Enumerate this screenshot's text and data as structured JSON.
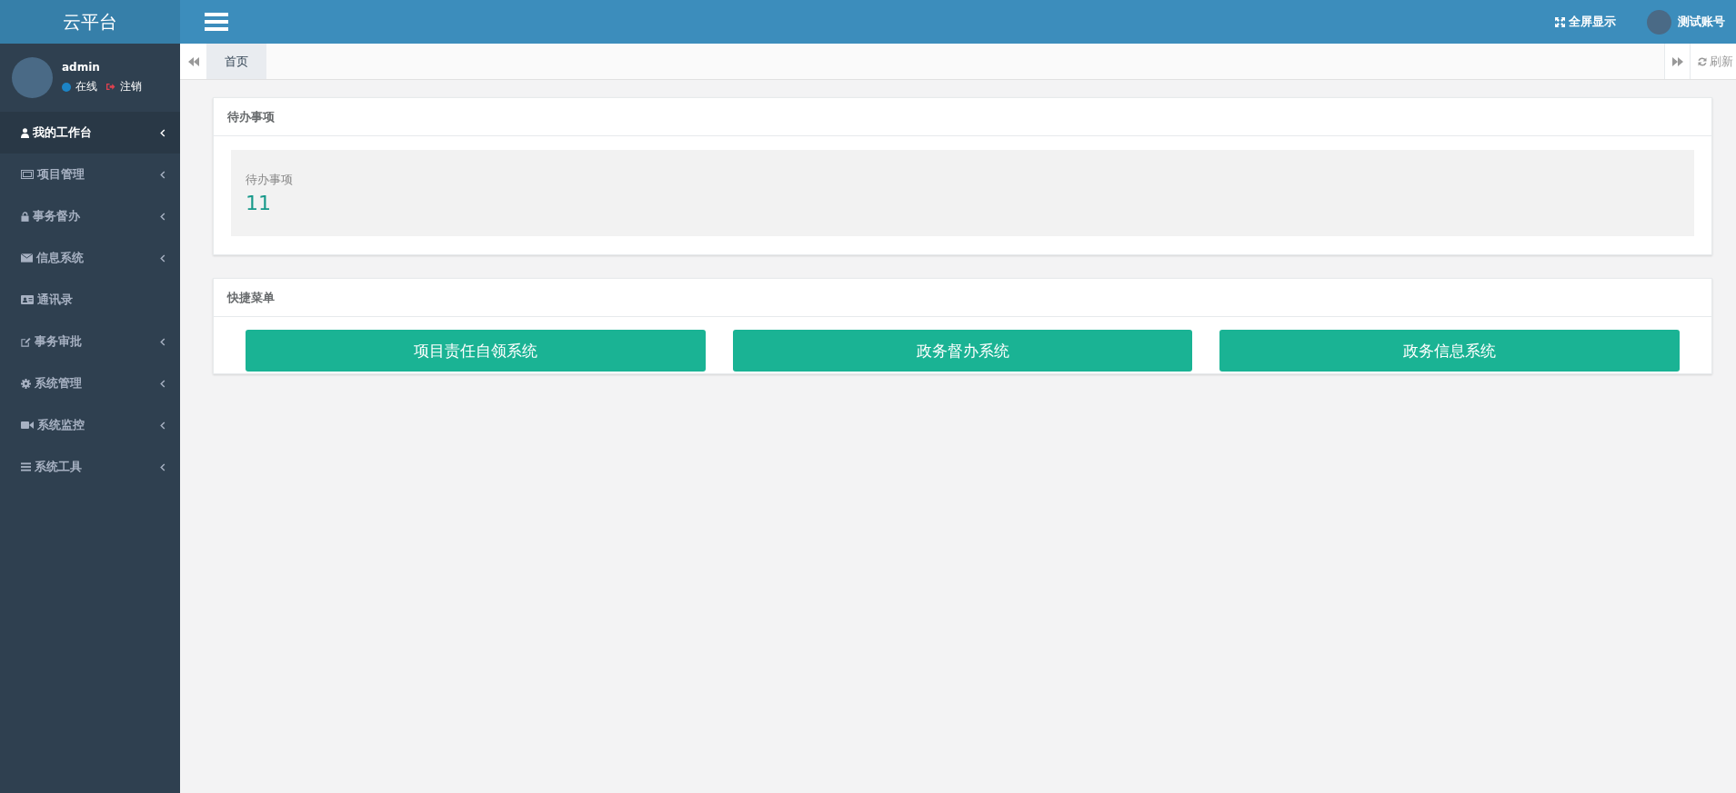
{
  "brand": "云平台",
  "user": {
    "name": "admin",
    "status": "在线",
    "logout": "注销"
  },
  "sidebar": {
    "items": [
      {
        "label": "我的工作台",
        "selected": true,
        "expandable": true
      },
      {
        "label": "项目管理",
        "selected": false,
        "expandable": true
      },
      {
        "label": "事务督办",
        "selected": false,
        "expandable": true
      },
      {
        "label": "信息系统",
        "selected": false,
        "expandable": true
      },
      {
        "label": "通讯录",
        "selected": false,
        "expandable": false
      },
      {
        "label": "事务审批",
        "selected": false,
        "expandable": true
      },
      {
        "label": "系统管理",
        "selected": false,
        "expandable": true
      },
      {
        "label": "系统监控",
        "selected": false,
        "expandable": true
      },
      {
        "label": "系统工具",
        "selected": false,
        "expandable": true
      }
    ]
  },
  "topbar": {
    "fullscreen": "全屏显示",
    "account": "测试账号"
  },
  "tabs": [
    {
      "label": "首页",
      "selected": true
    }
  ],
  "refresh": "刷新",
  "todo_panel": {
    "title": "待办事项",
    "stat_label": "待办事项",
    "stat_value": "11"
  },
  "quick_menu": {
    "title": "快捷菜单",
    "buttons": [
      "项目责任自领系统",
      "政务督办系统",
      "政务信息系统"
    ]
  }
}
